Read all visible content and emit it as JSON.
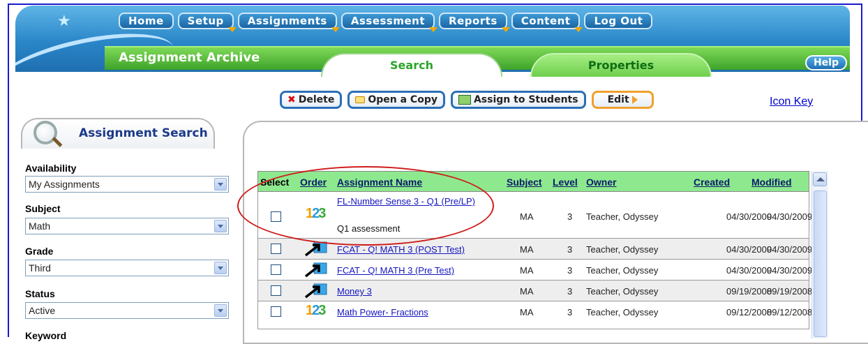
{
  "nav": {
    "items": [
      {
        "label": "Home",
        "dropdown": false
      },
      {
        "label": "Setup",
        "dropdown": true
      },
      {
        "label": "Assignments",
        "dropdown": true
      },
      {
        "label": "Assessment",
        "dropdown": true
      },
      {
        "label": "Reports",
        "dropdown": true
      },
      {
        "label": "Content",
        "dropdown": true
      },
      {
        "label": "Log Out",
        "dropdown": false
      }
    ],
    "help": "Help"
  },
  "header": {
    "section_title": "Assignment Archive",
    "tabs": [
      {
        "label": "Search",
        "active": true
      },
      {
        "label": "Properties",
        "active": false
      }
    ]
  },
  "toolbar": {
    "delete": "Delete",
    "open_copy": "Open a Copy",
    "assign": "Assign to Students",
    "edit": "Edit",
    "icon_key": "Icon Key"
  },
  "search_panel": {
    "title": "Assignment Search",
    "filters": [
      {
        "label": "Availability",
        "value": "My Assignments"
      },
      {
        "label": "Subject",
        "value": "Math"
      },
      {
        "label": "Grade",
        "value": "Third"
      },
      {
        "label": "Status",
        "value": "Active"
      }
    ],
    "next_label": "Keyword"
  },
  "table": {
    "columns": [
      "Select",
      "Order",
      "Assignment Name",
      "Subject",
      "Level",
      "Owner",
      "Created",
      "Modified"
    ],
    "rows": [
      {
        "icon": "123-icon",
        "name": "FL-Number Sense 3 - Q1 (Pre/LP)",
        "desc": "Q1 assessment",
        "subject": "MA",
        "level": "3",
        "owner": "Teacher, Odyssey",
        "created": "04/30/2009",
        "modified": "04/30/2009"
      },
      {
        "icon": "arrow-icon",
        "name": "FCAT - Q! MATH 3 (POST Test)",
        "desc": "",
        "subject": "MA",
        "level": "3",
        "owner": "Teacher, Odyssey",
        "created": "04/30/2009",
        "modified": "04/30/2009"
      },
      {
        "icon": "arrow-icon",
        "name": "FCAT - Q! MATH 3 (Pre Test)",
        "desc": "",
        "subject": "MA",
        "level": "3",
        "owner": "Teacher, Odyssey",
        "created": "04/30/2009",
        "modified": "04/30/2009"
      },
      {
        "icon": "arrow-icon",
        "name": "Money 3",
        "desc": "",
        "subject": "MA",
        "level": "3",
        "owner": "Teacher, Odyssey",
        "created": "09/19/2008",
        "modified": "09/19/2008"
      },
      {
        "icon": "123-icon",
        "name": "Math Power- Fractions",
        "desc": "",
        "subject": "MA",
        "level": "3",
        "owner": "Teacher, Odyssey",
        "created": "09/12/2008",
        "modified": "09/12/2008"
      }
    ]
  },
  "colors": {
    "frame": "#1a1acc",
    "header_green": "#8ee98e",
    "annotation": "#d01a1a"
  }
}
